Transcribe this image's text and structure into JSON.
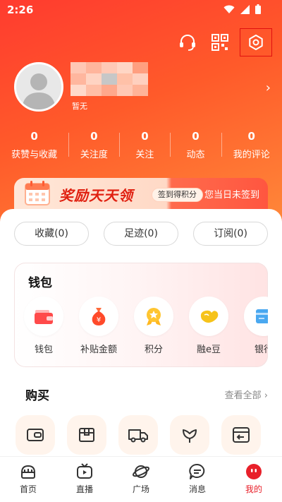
{
  "status": {
    "time": "2:26"
  },
  "profile": {
    "sub_text": "暂无"
  },
  "stats": [
    {
      "num": "0",
      "label": "获赞与收藏"
    },
    {
      "num": "0",
      "label": "关注度"
    },
    {
      "num": "0",
      "label": "关注"
    },
    {
      "num": "0",
      "label": "动态"
    },
    {
      "num": "0",
      "label": "我的评论"
    }
  ],
  "banner": {
    "title": "奖励天天领",
    "pill": "签到得积分",
    "status": "您当日未签到"
  },
  "tabs": [
    {
      "label": "收藏(0)"
    },
    {
      "label": "足迹(0)"
    },
    {
      "label": "订阅(0)"
    }
  ],
  "wallet": {
    "title": "钱包",
    "items": [
      {
        "label": "钱包",
        "icon": "wallet-icon"
      },
      {
        "label": "补贴金额",
        "icon": "money-bag-icon"
      },
      {
        "label": "积分",
        "icon": "medal-icon"
      },
      {
        "label": "融e豆",
        "icon": "bean-icon"
      },
      {
        "label": "银行",
        "icon": "bank-card-icon"
      }
    ]
  },
  "buy": {
    "title": "购买",
    "view_all": "查看全部"
  },
  "bottom_nav": [
    {
      "label": "首页",
      "icon": "home-icon"
    },
    {
      "label": "直播",
      "icon": "tv-icon"
    },
    {
      "label": "广场",
      "icon": "planet-icon"
    },
    {
      "label": "消息",
      "icon": "message-icon"
    },
    {
      "label": "我的",
      "icon": "profile-face-icon"
    }
  ],
  "colors": {
    "accent": "#e8202a",
    "header": "#ff4a2c"
  }
}
